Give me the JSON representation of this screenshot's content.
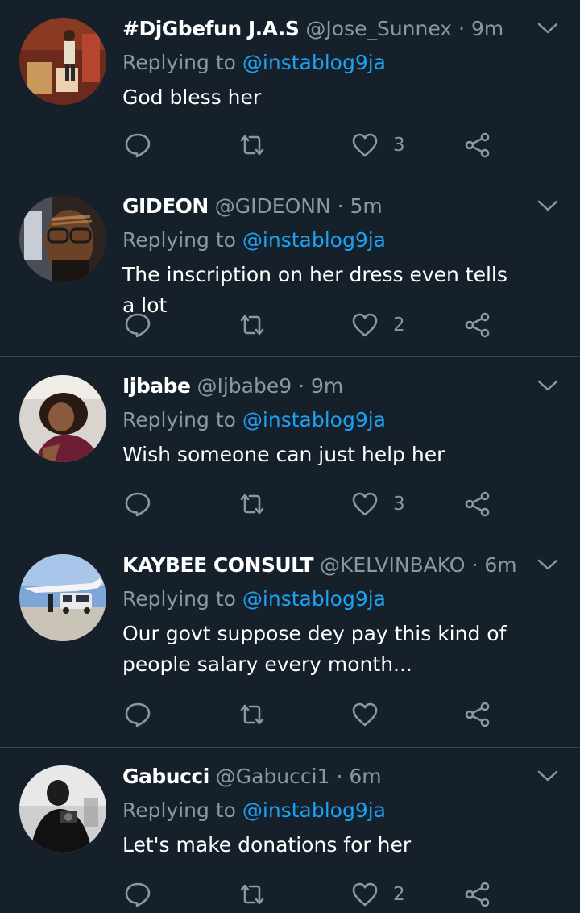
{
  "replying_label": "Replying to",
  "colors": {
    "background": "#15202b",
    "divider": "#38444d",
    "secondary_text": "#8899a6",
    "mention": "#1da1f2"
  },
  "replies": [
    {
      "name": "#DjGbefun J.A.S",
      "handle": "@Jose_Sunnex",
      "time": "9m",
      "replying_to": "@instablog9ja",
      "text": "God bless her",
      "likes": "3"
    },
    {
      "name": "GIDEON",
      "handle": "@GIDEONN",
      "time": "5m",
      "replying_to": "@instablog9ja",
      "text": "The inscription on her dress even tells a lot",
      "likes": "2"
    },
    {
      "name": "Ijbabe",
      "handle": "@Ijbabe9",
      "time": "9m",
      "replying_to": "@instablog9ja",
      "text": "Wish someone can just help her",
      "likes": "3"
    },
    {
      "name": "KAYBEE CONSULT",
      "handle": "@KELVINBAKO",
      "time": "6m",
      "replying_to": "@instablog9ja",
      "text": "Our govt suppose dey pay this kind of people salary every month...",
      "likes": ""
    },
    {
      "name": "Gabucci",
      "handle": "@Gabucci1",
      "time": "6m",
      "replying_to": "@instablog9ja",
      "text": "Let's make donations for her",
      "likes": "2"
    }
  ]
}
